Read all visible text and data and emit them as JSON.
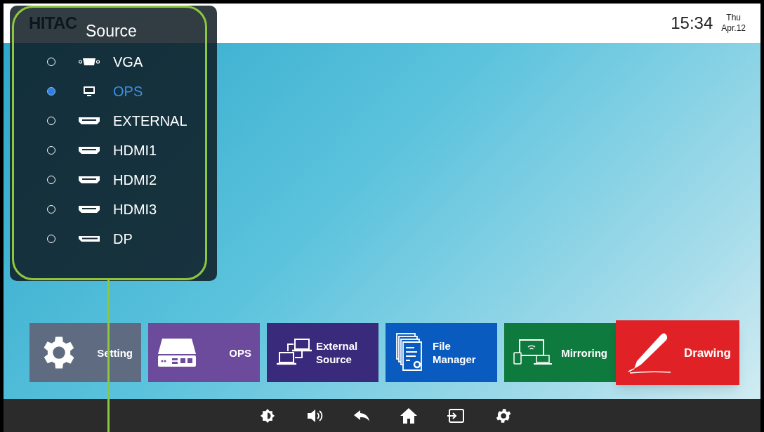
{
  "top_bar": {
    "logo": "HITAC",
    "time": "15:34",
    "weekday": "Thu",
    "date": "Apr.12"
  },
  "source_menu": {
    "title": "Source",
    "items": [
      {
        "label": "VGA",
        "kind": "vga",
        "selected": false
      },
      {
        "label": "OPS",
        "kind": "pc",
        "selected": true
      },
      {
        "label": "EXTERNAL",
        "kind": "hdmi",
        "selected": false
      },
      {
        "label": "HDMI1",
        "kind": "hdmi",
        "selected": false
      },
      {
        "label": "HDMI2",
        "kind": "hdmi",
        "selected": false
      },
      {
        "label": "HDMI3",
        "kind": "hdmi",
        "selected": false
      },
      {
        "label": "DP",
        "kind": "dp",
        "selected": false
      }
    ]
  },
  "tiles": [
    {
      "label": "Setting",
      "kind": "setting",
      "color": "#5e6b80",
      "selected": false
    },
    {
      "label": "OPS",
      "kind": "ops",
      "color": "#6c4a9c",
      "selected": false
    },
    {
      "label": "External Source",
      "kind": "external",
      "color": "#3a2a7c",
      "selected": false
    },
    {
      "label": "File Manager",
      "kind": "files",
      "color": "#0a5bbf",
      "selected": false
    },
    {
      "label": "Mirroring",
      "kind": "mirroring",
      "color": "#0f7a3d",
      "selected": false
    },
    {
      "label": "Drawing",
      "kind": "drawing",
      "color": "#e02226",
      "selected": true
    }
  ],
  "nav_bar": [
    {
      "kind": "brightness"
    },
    {
      "kind": "volume"
    },
    {
      "kind": "back"
    },
    {
      "kind": "home"
    },
    {
      "kind": "input"
    },
    {
      "kind": "settings"
    }
  ]
}
